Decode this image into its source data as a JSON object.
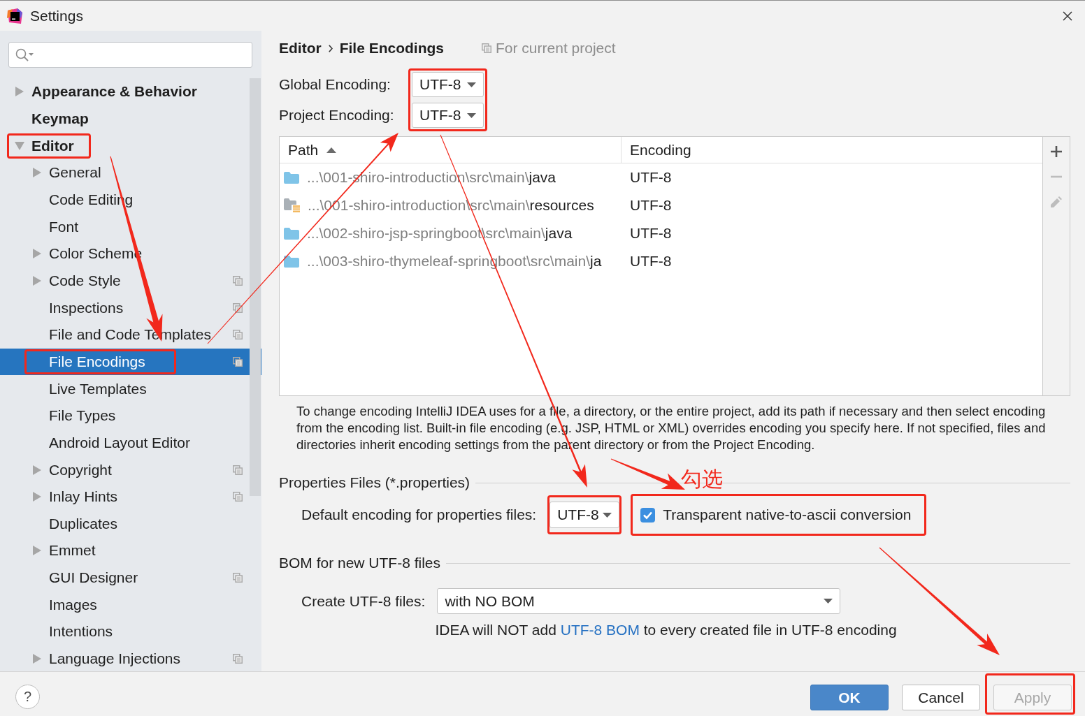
{
  "window": {
    "title": "Settings"
  },
  "sidebar": {
    "items": [
      {
        "label": "Appearance & Behavior",
        "kind": "node",
        "expanded": false,
        "selected": false,
        "marked": false,
        "project_scope": false
      },
      {
        "label": "Keymap",
        "kind": "leaf",
        "selected": false,
        "marked": false,
        "project_scope": false
      },
      {
        "label": "Editor",
        "kind": "node",
        "expanded": true,
        "selected": false,
        "marked": true,
        "project_scope": false,
        "children": [
          {
            "label": "General",
            "kind": "node",
            "expanded": false,
            "selected": false,
            "marked": false,
            "project_scope": false
          },
          {
            "label": "Code Editing",
            "kind": "leaf",
            "selected": false,
            "marked": false,
            "project_scope": false
          },
          {
            "label": "Font",
            "kind": "leaf",
            "selected": false,
            "marked": false,
            "project_scope": false
          },
          {
            "label": "Color Scheme",
            "kind": "node",
            "expanded": false,
            "selected": false,
            "marked": false,
            "project_scope": false
          },
          {
            "label": "Code Style",
            "kind": "node",
            "expanded": false,
            "selected": false,
            "marked": false,
            "project_scope": true
          },
          {
            "label": "Inspections",
            "kind": "leaf",
            "selected": false,
            "marked": false,
            "project_scope": true
          },
          {
            "label": "File and Code Templates",
            "kind": "leaf",
            "selected": false,
            "marked": false,
            "project_scope": true
          },
          {
            "label": "File Encodings",
            "kind": "leaf",
            "selected": true,
            "marked": true,
            "project_scope": true
          },
          {
            "label": "Live Templates",
            "kind": "leaf",
            "selected": false,
            "marked": false,
            "project_scope": false
          },
          {
            "label": "File Types",
            "kind": "leaf",
            "selected": false,
            "marked": false,
            "project_scope": false
          },
          {
            "label": "Android Layout Editor",
            "kind": "leaf",
            "selected": false,
            "marked": false,
            "project_scope": false
          },
          {
            "label": "Copyright",
            "kind": "node",
            "expanded": false,
            "selected": false,
            "marked": false,
            "project_scope": true
          },
          {
            "label": "Inlay Hints",
            "kind": "node",
            "expanded": false,
            "selected": false,
            "marked": false,
            "project_scope": true
          },
          {
            "label": "Duplicates",
            "kind": "leaf",
            "selected": false,
            "marked": false,
            "project_scope": false
          },
          {
            "label": "Emmet",
            "kind": "node",
            "expanded": false,
            "selected": false,
            "marked": false,
            "project_scope": false
          },
          {
            "label": "GUI Designer",
            "kind": "leaf",
            "selected": false,
            "marked": false,
            "project_scope": true
          },
          {
            "label": "Images",
            "kind": "leaf",
            "selected": false,
            "marked": false,
            "project_scope": false
          },
          {
            "label": "Intentions",
            "kind": "leaf",
            "selected": false,
            "marked": false,
            "project_scope": false
          },
          {
            "label": "Language Injections",
            "kind": "node",
            "expanded": false,
            "selected": false,
            "marked": false,
            "project_scope": true
          }
        ]
      }
    ]
  },
  "breadcrumb": {
    "items": [
      "Editor",
      "File Encodings"
    ],
    "scope": "For current project"
  },
  "encodings": {
    "marked": true,
    "fields": [
      {
        "label": "Global Encoding:",
        "value": "UTF-8"
      },
      {
        "label": "Project Encoding:",
        "value": "UTF-8"
      }
    ]
  },
  "table": {
    "columns": [
      {
        "label": "Path",
        "sorted": true
      },
      {
        "label": "Encoding",
        "sorted": false
      }
    ],
    "rows": [
      {
        "kind": "source",
        "path": "...\\001-shiro-introduction\\src\\main\\",
        "folder": "java",
        "encoding": "UTF-8"
      },
      {
        "kind": "resources",
        "path": "...\\001-shiro-introduction\\src\\main\\",
        "folder": "resources",
        "encoding": "UTF-8"
      },
      {
        "kind": "source",
        "path": "...\\002-shiro-jsp-springboot\\src\\main\\",
        "folder": "java",
        "encoding": "UTF-8"
      },
      {
        "kind": "source",
        "path": "...\\003-shiro-thymeleaf-springboot\\src\\main\\",
        "folder": "ja",
        "encoding": "UTF-8"
      }
    ],
    "toolbar": [
      {
        "kind": "add",
        "disabled": false
      },
      {
        "kind": "remove",
        "disabled": true
      },
      {
        "kind": "edit",
        "disabled": true
      }
    ]
  },
  "description": "To change encoding IntelliJ IDEA uses for a file, a directory, or the entire project, add its path if necessary and then select encoding from the encoding list. Built-in file encoding (e.g. JSP, HTML or XML) overrides encoding you specify here. If not specified, files and directories inherit encoding settings from the parent directory or from the Project Encoding.",
  "properties_files": {
    "title": "Properties Files (*.properties)",
    "default_encoding": {
      "label": "Default encoding for properties files:",
      "value": "UTF-8",
      "marked": true
    },
    "native_to_ascii": {
      "label": "Transparent native-to-ascii conversion",
      "checked": true,
      "marked": true
    },
    "annotation": "勾选"
  },
  "bom": {
    "title": "BOM for new UTF-8 files",
    "create": {
      "label": "Create UTF-8 files:",
      "value": "with NO BOM"
    },
    "hint": {
      "before": "IDEA will NOT add",
      "link": "UTF-8 BOM",
      "after": "to every created file in UTF-8 encoding"
    }
  },
  "footer": {
    "help": "?",
    "buttons": [
      {
        "label": "OK",
        "kind": "primary",
        "disabled": false,
        "marked": false
      },
      {
        "label": "Cancel",
        "kind": "secondary",
        "disabled": false,
        "marked": false
      },
      {
        "label": "Apply",
        "kind": "secondary",
        "disabled": true,
        "marked": true
      }
    ]
  }
}
